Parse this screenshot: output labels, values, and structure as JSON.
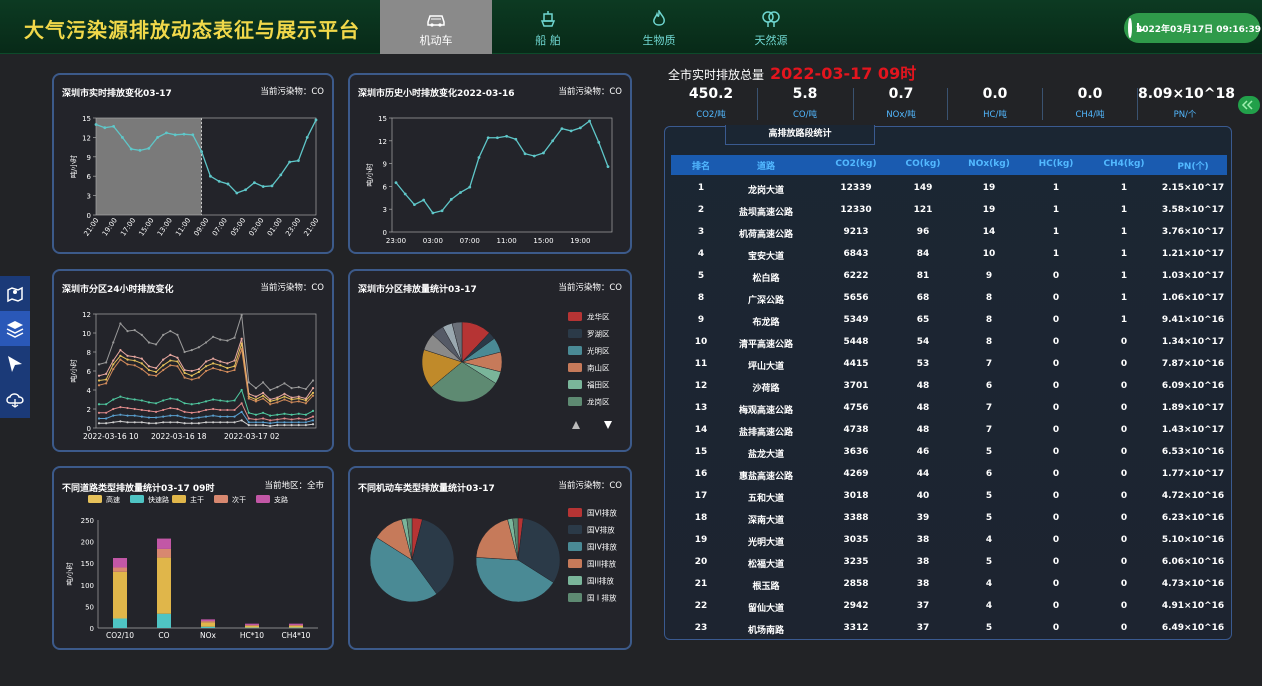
{
  "header": {
    "title": "大气污染源排放动态表征与展示平台",
    "datetime": "2022年03月17日 09:16:39",
    "tabs": [
      {
        "label": "机动车",
        "icon": "car-icon",
        "active": true
      },
      {
        "label": "船 舶",
        "icon": "ship-icon",
        "active": false
      },
      {
        "label": "生物质",
        "icon": "flame-icon",
        "active": false
      },
      {
        "label": "天然源",
        "icon": "tree-icon",
        "active": false
      }
    ]
  },
  "sidebar": {
    "icons": [
      "map-pin-icon",
      "layers-icon",
      "arrow-cursor-icon",
      "cloud-icon"
    ]
  },
  "panels": {
    "p1": {
      "title": "深圳市实时排放变化03-17",
      "right": "当前污染物：CO"
    },
    "p2": {
      "title": "深圳市历史小时排放变化2022-03-16",
      "right": "当前污染物：CO"
    },
    "p3": {
      "title": "深圳市分区24小时排放变化",
      "right": "当前污染物：CO"
    },
    "p4": {
      "title": "深圳市分区排放量统计03-17",
      "right": "当前污染物：CO"
    },
    "p5": {
      "title": "不同道路类型排放量统计03-17 09时",
      "right": "当前地区：全市"
    },
    "p6": {
      "title": "不同机动车类型排放量统计03-17",
      "right": "当前污染物：CO"
    }
  },
  "summary": {
    "title": "全市实时排放总量",
    "time": "2022-03-17 09时",
    "kpis": [
      {
        "value": "450.2",
        "unit": "CO2/吨"
      },
      {
        "value": "5.8",
        "unit": "CO/吨"
      },
      {
        "value": "0.7",
        "unit": "NOx/吨"
      },
      {
        "value": "0.0",
        "unit": "HC/吨"
      },
      {
        "value": "0.0",
        "unit": "CH4/吨"
      },
      {
        "value": "8.09×10^18",
        "unit": "PN/个"
      }
    ]
  },
  "ranking": {
    "tab": "高排放路段统计",
    "columns": [
      "排名",
      "道路",
      "CO2(kg)",
      "CO(kg)",
      "NOx(kg)",
      "HC(kg)",
      "CH4(kg)",
      "PN(个)"
    ],
    "rows": [
      [
        "1",
        "龙岗大道",
        "12339",
        "149",
        "19",
        "1",
        "1",
        "2.15×10^17"
      ],
      [
        "2",
        "盐坝高速公路",
        "12330",
        "121",
        "19",
        "1",
        "1",
        "3.58×10^17"
      ],
      [
        "3",
        "机荷高速公路",
        "9213",
        "96",
        "14",
        "1",
        "1",
        "3.76×10^17"
      ],
      [
        "4",
        "宝安大道",
        "6843",
        "84",
        "10",
        "1",
        "1",
        "1.21×10^17"
      ],
      [
        "5",
        "松白路",
        "6222",
        "81",
        "9",
        "0",
        "1",
        "1.03×10^17"
      ],
      [
        "8",
        "广深公路",
        "5656",
        "68",
        "8",
        "0",
        "1",
        "1.06×10^17"
      ],
      [
        "9",
        "布龙路",
        "5349",
        "65",
        "8",
        "0",
        "1",
        "9.41×10^16"
      ],
      [
        "10",
        "清平高速公路",
        "5448",
        "54",
        "8",
        "0",
        "0",
        "1.34×10^17"
      ],
      [
        "11",
        "坪山大道",
        "4415",
        "53",
        "7",
        "0",
        "0",
        "7.87×10^16"
      ],
      [
        "12",
        "沙荷路",
        "3701",
        "48",
        "6",
        "0",
        "0",
        "6.09×10^16"
      ],
      [
        "13",
        "梅观高速公路",
        "4756",
        "48",
        "7",
        "0",
        "0",
        "1.89×10^17"
      ],
      [
        "14",
        "盐排高速公路",
        "4738",
        "48",
        "7",
        "0",
        "0",
        "1.43×10^17"
      ],
      [
        "15",
        "盐龙大道",
        "3636",
        "46",
        "5",
        "0",
        "0",
        "6.53×10^16"
      ],
      [
        "16",
        "惠盐高速公路",
        "4269",
        "44",
        "6",
        "0",
        "0",
        "1.77×10^17"
      ],
      [
        "17",
        "五和大道",
        "3018",
        "40",
        "5",
        "0",
        "0",
        "4.72×10^16"
      ],
      [
        "18",
        "深南大道",
        "3388",
        "39",
        "5",
        "0",
        "0",
        "6.23×10^16"
      ],
      [
        "19",
        "光明大道",
        "3035",
        "38",
        "4",
        "0",
        "0",
        "5.10×10^16"
      ],
      [
        "20",
        "松福大道",
        "3235",
        "38",
        "5",
        "0",
        "0",
        "6.06×10^16"
      ],
      [
        "21",
        "根玉路",
        "2858",
        "38",
        "4",
        "0",
        "0",
        "4.73×10^16"
      ],
      [
        "22",
        "留仙大道",
        "2942",
        "37",
        "4",
        "0",
        "0",
        "4.91×10^16"
      ],
      [
        "23",
        "机场南路",
        "3312",
        "37",
        "5",
        "0",
        "0",
        "6.49×10^16"
      ]
    ]
  },
  "chart_data": [
    {
      "type": "line",
      "title": "深圳市实时排放变化03-17",
      "ylabel": "吨/小时",
      "ylim": [
        0,
        15
      ],
      "yticks": [
        0,
        3,
        6,
        9,
        12,
        15
      ],
      "x": [
        "21:00",
        "20:00",
        "19:00",
        "18:00",
        "17:00",
        "16:00",
        "15:00",
        "14:00",
        "13:00",
        "12:00",
        "11:00",
        "10:00",
        "09:00",
        "08:00",
        "07:00",
        "06:00",
        "05:00",
        "04:00",
        "03:00",
        "02:00",
        "01:00",
        "00:00",
        "23:00",
        "22:00",
        "21:00"
      ],
      "xticks": [
        "21:00",
        "19:00",
        "17:00",
        "15:00",
        "13:00",
        "11:00",
        "09:00",
        "07:00",
        "05:00",
        "03:00",
        "01:00",
        "23:00",
        "21:00"
      ],
      "values": [
        14,
        13.5,
        13.7,
        12,
        10.2,
        10,
        10.3,
        12,
        12.7,
        12.4,
        12.5,
        12.4,
        9.8,
        6,
        5.2,
        4.8,
        3.4,
        3.9,
        5,
        4.4,
        4.5,
        6.2,
        8.2,
        8.4,
        12,
        14.7
      ],
      "shaded_until": "09:00"
    },
    {
      "type": "line",
      "title": "深圳市历史小时排放变化2022-03-16",
      "ylabel": "吨/小时",
      "ylim": [
        0,
        15
      ],
      "yticks": [
        0,
        3,
        6,
        9,
        12,
        15
      ],
      "xticks": [
        "23:00",
        "03:00",
        "07:00",
        "11:00",
        "15:00",
        "19:00"
      ],
      "values": [
        6.5,
        5,
        3.6,
        4.2,
        2.5,
        2.8,
        4.3,
        5.2,
        5.9,
        9.8,
        12.4,
        12.4,
        12.6,
        12.2,
        10.3,
        10,
        10.4,
        12,
        13.6,
        13.3,
        13.7,
        14.6,
        11.8,
        8.6
      ]
    },
    {
      "type": "line",
      "title": "深圳市分区24小时排放变化",
      "ylabel": "吨/小时",
      "ylim": [
        0,
        12
      ],
      "yticks": [
        0,
        2,
        4,
        6,
        8,
        10,
        12
      ],
      "xticks": [
        "2022-03-16 10",
        "2022-03-16 18",
        "2022-03-17 02"
      ],
      "series": [
        {
          "color": "#9a9a9a",
          "values": [
            6.7,
            6.9,
            9,
            11,
            10.2,
            10.3,
            9.8,
            9,
            8.8,
            9.8,
            10.2,
            9.8,
            8,
            8.2,
            8.5,
            9,
            9.6,
            9.3,
            9.2,
            9.5,
            11.9,
            4.8,
            4.2,
            4.8,
            4,
            4.3,
            4.7,
            4.2,
            4.3,
            4.1,
            5
          ]
        },
        {
          "color": "#e8a8a0",
          "values": [
            5.5,
            5.7,
            7.1,
            8.2,
            7.6,
            7.5,
            7.3,
            6.5,
            6.3,
            7.2,
            7.7,
            7.4,
            6.1,
            6,
            6.2,
            7,
            7.3,
            7,
            6.8,
            7.1,
            9.4,
            3.6,
            3.3,
            3.7,
            3,
            3.2,
            3.6,
            3.2,
            3.3,
            3.1,
            4.2
          ]
        },
        {
          "color": "#e6c15a",
          "values": [
            5,
            5.1,
            6.7,
            7.6,
            7.2,
            7.1,
            6.8,
            6.1,
            5.9,
            6.6,
            7.1,
            7,
            5.8,
            5.5,
            5.9,
            6.5,
            6.8,
            6.6,
            6.3,
            6.5,
            8.9,
            3.3,
            3,
            3.4,
            2.8,
            3,
            3.3,
            3,
            3.1,
            2.9,
            3.7
          ]
        },
        {
          "color": "#d18a5a",
          "values": [
            4.5,
            4.7,
            6.2,
            7.2,
            6.7,
            6.6,
            6.2,
            5.6,
            5.5,
            6.1,
            6.6,
            6.5,
            5.3,
            5.1,
            5.3,
            6,
            6.3,
            6.1,
            5.9,
            6.1,
            8.3,
            3.1,
            2.8,
            3.1,
            2.5,
            2.7,
            3,
            2.7,
            2.8,
            2.6,
            3.4
          ]
        },
        {
          "color": "#4fc9a0",
          "values": [
            2.5,
            2.5,
            3,
            3.3,
            3.1,
            3,
            2.9,
            2.7,
            2.6,
            2.9,
            3.1,
            3,
            2.6,
            2.5,
            2.6,
            2.8,
            3,
            2.9,
            2.8,
            2.9,
            4,
            1.6,
            1.4,
            1.6,
            1.3,
            1.4,
            1.5,
            1.4,
            1.5,
            1.4,
            1.8
          ]
        },
        {
          "color": "#e08a8a",
          "values": [
            1.6,
            1.6,
            2,
            2.2,
            2.1,
            2,
            1.9,
            1.8,
            1.7,
            1.9,
            2.1,
            2,
            1.7,
            1.6,
            1.7,
            1.9,
            2,
            1.9,
            1.9,
            1.9,
            2.6,
            1,
            0.9,
            1,
            0.8,
            0.9,
            1,
            0.9,
            1,
            0.9,
            1.2
          ]
        },
        {
          "color": "#5aa0d0",
          "values": [
            1,
            1,
            1.3,
            1.4,
            1.3,
            1.3,
            1.2,
            1.1,
            1.1,
            1.2,
            1.3,
            1.3,
            1.1,
            1,
            1.1,
            1.2,
            1.3,
            1.2,
            1.2,
            1.2,
            1.7,
            0.6,
            0.6,
            0.6,
            0.5,
            0.6,
            0.6,
            0.6,
            0.6,
            0.6,
            0.8
          ]
        },
        {
          "color": "#cfcfcf",
          "values": [
            0.5,
            0.5,
            0.6,
            0.7,
            0.6,
            0.6,
            0.6,
            0.5,
            0.5,
            0.6,
            0.6,
            0.6,
            0.5,
            0.5,
            0.5,
            0.6,
            0.6,
            0.6,
            0.6,
            0.6,
            0.8,
            0.3,
            0.3,
            0.3,
            0.2,
            0.3,
            0.3,
            0.3,
            0.3,
            0.3,
            0.4
          ]
        }
      ]
    },
    {
      "type": "pie",
      "title": "深圳市分区排放量统计03-17",
      "legend": [
        {
          "name": "龙华区",
          "color": "#b63434"
        },
        {
          "name": "罗湖区",
          "color": "#2b3a48"
        },
        {
          "name": "光明区",
          "color": "#4a8a95"
        },
        {
          "name": "南山区",
          "color": "#c67a5a"
        },
        {
          "name": "福田区",
          "color": "#7ab59a"
        },
        {
          "name": "龙岗区",
          "color": "#5e8a72"
        }
      ],
      "slices": [
        {
          "color": "#b63434",
          "value": 12
        },
        {
          "color": "#2b3a48",
          "value": 3
        },
        {
          "color": "#4a8a95",
          "value": 6
        },
        {
          "color": "#c67a5a",
          "value": 8
        },
        {
          "color": "#7ab59a",
          "value": 5
        },
        {
          "color": "#5e8a72",
          "value": 30
        },
        {
          "color": "#c08a2a",
          "value": 16
        },
        {
          "color": "#8a8a8a",
          "value": 7
        },
        {
          "color": "#555a66",
          "value": 5
        },
        {
          "color": "#9aa8b0",
          "value": 4
        },
        {
          "color": "#6a6f78",
          "value": 4
        }
      ]
    },
    {
      "type": "bar",
      "title": "不同道路类型排放量统计03-17 09时",
      "ylabel": "吨/小时",
      "ylim": [
        0,
        250
      ],
      "yticks": [
        0,
        50,
        100,
        150,
        200,
        250
      ],
      "categories": [
        "CO2/10",
        "CO",
        "NOx",
        "HC*10",
        "CH4*10"
      ],
      "series": [
        {
          "name": "高速",
          "color": "#e6c15a",
          "values": [
            0,
            0,
            0,
            0,
            0
          ]
        },
        {
          "name": "快速路",
          "color": "#4fc4c4",
          "values": [
            22,
            33,
            3,
            1,
            1
          ]
        },
        {
          "name": "主干",
          "color": "#e0b64a",
          "values": [
            108,
            130,
            10,
            4,
            4
          ]
        },
        {
          "name": "次干",
          "color": "#d88870",
          "values": [
            10,
            20,
            3,
            2,
            2
          ]
        },
        {
          "name": "支路",
          "color": "#c257a6",
          "values": [
            22,
            24,
            4,
            3,
            3
          ]
        }
      ]
    },
    {
      "type": "pie",
      "title": "不同机动车类型排放量统计03-17",
      "legend": [
        {
          "name": "国VI排放",
          "color": "#b63434"
        },
        {
          "name": "国V排放",
          "color": "#2b3a48"
        },
        {
          "name": "国IV排放",
          "color": "#4a8a95"
        },
        {
          "name": "国III排放",
          "color": "#c67a5a"
        },
        {
          "name": "国II排放",
          "color": "#7ab59a"
        },
        {
          "name": "国 I 排放",
          "color": "#5e8a72"
        }
      ],
      "pies": [
        {
          "slices": [
            {
              "color": "#b63434",
              "value": 4
            },
            {
              "color": "#2b3a48",
              "value": 36
            },
            {
              "color": "#4a8a95",
              "value": 44
            },
            {
              "color": "#c67a5a",
              "value": 12
            },
            {
              "color": "#7ab59a",
              "value": 2
            },
            {
              "color": "#5e8a72",
              "value": 2
            }
          ]
        },
        {
          "slices": [
            {
              "color": "#b63434",
              "value": 2
            },
            {
              "color": "#2b3a48",
              "value": 32
            },
            {
              "color": "#4a8a95",
              "value": 42
            },
            {
              "color": "#c67a5a",
              "value": 20
            },
            {
              "color": "#7ab59a",
              "value": 2
            },
            {
              "color": "#5e8a72",
              "value": 2
            }
          ]
        }
      ]
    }
  ]
}
